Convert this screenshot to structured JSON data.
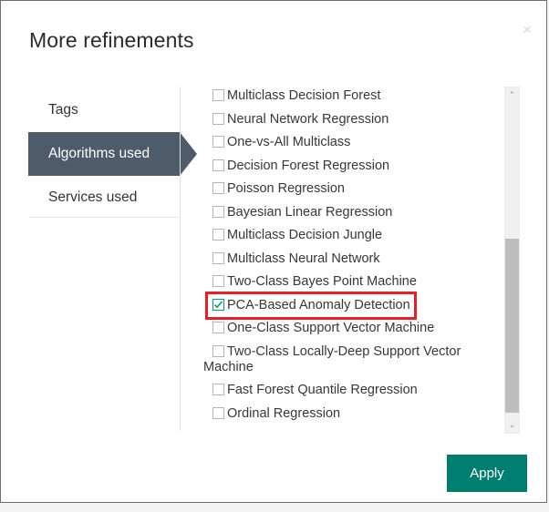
{
  "dialog": {
    "title": "More refinements",
    "close_icon": "close-icon",
    "close_glyph": "×"
  },
  "tabs": [
    {
      "label": "Tags",
      "selected": false
    },
    {
      "label": "Algorithms used",
      "selected": true
    },
    {
      "label": "Services used",
      "selected": false
    }
  ],
  "options": [
    {
      "label": "Multiclass Decision Forest",
      "checked": false,
      "highlighted": false
    },
    {
      "label": "Neural Network Regression",
      "checked": false,
      "highlighted": false
    },
    {
      "label": "One-vs-All Multiclass",
      "checked": false,
      "highlighted": false
    },
    {
      "label": "Decision Forest Regression",
      "checked": false,
      "highlighted": false
    },
    {
      "label": "Poisson Regression",
      "checked": false,
      "highlighted": false
    },
    {
      "label": "Bayesian Linear Regression",
      "checked": false,
      "highlighted": false
    },
    {
      "label": "Multiclass Decision Jungle",
      "checked": false,
      "highlighted": false
    },
    {
      "label": "Multiclass Neural Network",
      "checked": false,
      "highlighted": false
    },
    {
      "label": "Two-Class Bayes Point Machine",
      "checked": false,
      "highlighted": false
    },
    {
      "label": "PCA-Based Anomaly Detection",
      "checked": true,
      "highlighted": true
    },
    {
      "label": "One-Class Support Vector Machine",
      "checked": false,
      "highlighted": false
    },
    {
      "label": "Two-Class Locally-Deep Support Vector Machine",
      "checked": false,
      "highlighted": false
    },
    {
      "label": "Fast Forest Quantile Regression",
      "checked": false,
      "highlighted": false
    },
    {
      "label": "Ordinal Regression",
      "checked": false,
      "highlighted": false
    }
  ],
  "scrollbar": {
    "up_arrow_glyph": "⌃",
    "down_arrow_glyph": "⌄",
    "thumb_name": "scrollbar-thumb"
  },
  "footer": {
    "apply_label": "Apply"
  },
  "colors": {
    "selected_tab": "#4e5b6b",
    "apply_button": "#007f70",
    "checkbox_checked": "#00a07e",
    "highlight_outline": "#ee1c25"
  }
}
